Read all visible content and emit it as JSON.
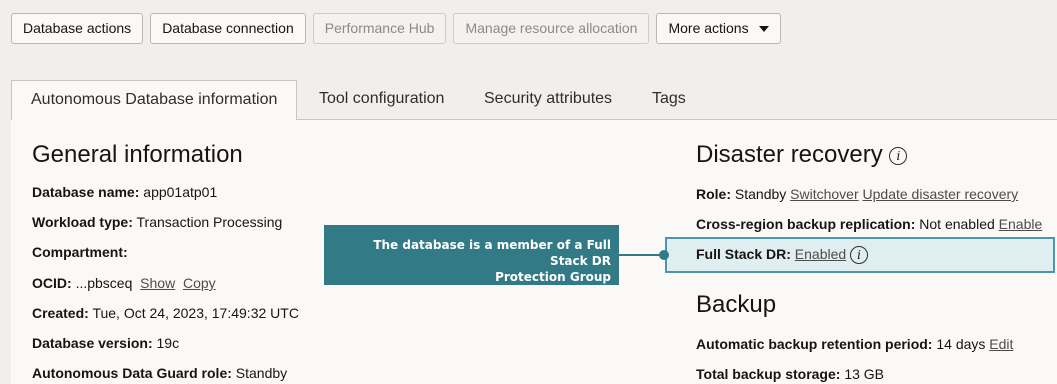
{
  "toolbar": {
    "buttons": [
      {
        "label": "Database actions",
        "disabled": false
      },
      {
        "label": "Database connection",
        "disabled": false
      },
      {
        "label": "Performance Hub",
        "disabled": true
      },
      {
        "label": "Manage resource allocation",
        "disabled": true
      },
      {
        "label": "More actions",
        "disabled": false
      }
    ]
  },
  "tabs": [
    {
      "label": "Autonomous Database information",
      "active": true
    },
    {
      "label": "Tool configuration"
    },
    {
      "label": "Security attributes"
    },
    {
      "label": "Tags"
    }
  ],
  "general": {
    "title": "General information",
    "db_name_label": "Database name:",
    "db_name_value": "app01atp01",
    "workload_label": "Workload type:",
    "workload_value": "Transaction Processing",
    "compartment_label": "Compartment:",
    "ocid_label": "OCID:",
    "ocid_value": "...pbsceq",
    "ocid_show": "Show",
    "ocid_copy": "Copy",
    "created_label": "Created:",
    "created_value": "Tue, Oct 24, 2023, 17:49:32 UTC",
    "version_label": "Database version:",
    "version_value": "19c",
    "dg_role_label": "Autonomous Data Guard role:",
    "dg_role_value": "Standby"
  },
  "dr": {
    "title": "Disaster recovery",
    "role_label": "Role:",
    "role_value": "Standby",
    "switchover": "Switchover",
    "update_dr": "Update disaster recovery",
    "crb_label": "Cross-region backup replication:",
    "crb_value": "Not enabled",
    "crb_enable": "Enable",
    "fsdr_label": "Full Stack DR:",
    "fsdr_value": "Enabled"
  },
  "backup": {
    "title": "Backup",
    "retention_label": "Automatic backup retention period:",
    "retention_value": "14 days",
    "retention_edit": "Edit",
    "storage_label": "Total backup storage:",
    "storage_value": "13 GB"
  },
  "callout": {
    "line1": "The database is a member of a Full Stack DR",
    "line2": "Protection Group"
  },
  "colors": {
    "accent": "#337a87",
    "highlight_bg": "#dfeef0",
    "highlight_border": "#4c97a5"
  }
}
